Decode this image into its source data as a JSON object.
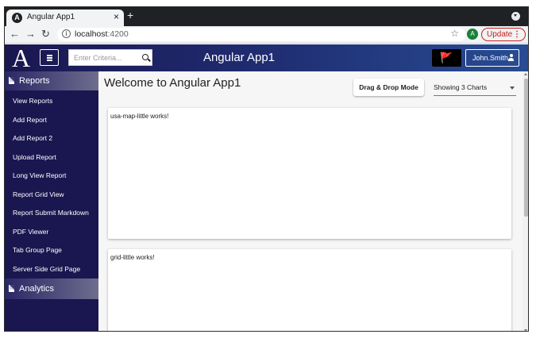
{
  "browser": {
    "tab_title": "Angular App1",
    "favicon_letter": "A",
    "tab_close": "×",
    "new_tab": "+",
    "url_host": "localhost",
    "url_port": ":4200",
    "profile_letter": "A",
    "update_label": "Update",
    "info_glyph": "i"
  },
  "header": {
    "brand": "A",
    "search_placeholder": "Enter Criteria...",
    "title": "Angular App1",
    "user_label": "John.Smith",
    "accent_colors": [
      "#1a1750",
      "#284c93"
    ]
  },
  "sidebar": {
    "sections": [
      {
        "label": "Reports",
        "icon": "document-icon"
      },
      {
        "label": "Analytics",
        "icon": "document-icon"
      }
    ],
    "items": [
      {
        "label": "View Reports"
      },
      {
        "label": "Add Report"
      },
      {
        "label": "Add Report 2"
      },
      {
        "label": "Upload Report"
      },
      {
        "label": "Long View Report"
      },
      {
        "label": "Report Grid View"
      },
      {
        "label": "Report Submit Markdown"
      },
      {
        "label": "PDF Viewer"
      },
      {
        "label": "Tab Group Page"
      },
      {
        "label": "Server Side Grid Page"
      }
    ]
  },
  "main": {
    "welcome": "Welcome to Angular App1",
    "dnd_button": "Drag & Drop Mode",
    "charts_select": "Showing 3 Charts",
    "cards": [
      {
        "text": "usa-map-little works!"
      },
      {
        "text": "grid-little works!"
      }
    ]
  }
}
